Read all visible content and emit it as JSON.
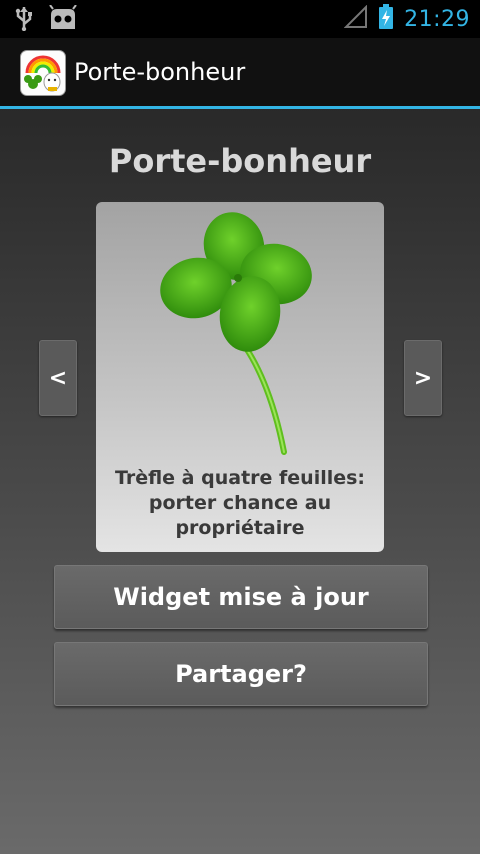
{
  "status_bar": {
    "time": "21:29",
    "icons": [
      "usb-icon",
      "android-debug-icon",
      "no-signal-icon",
      "battery-charging-icon"
    ]
  },
  "action_bar": {
    "title": "Porte-bonheur",
    "icon": "app-icon"
  },
  "main": {
    "heading": "Porte-bonheur",
    "card": {
      "image": "four-leaf-clover",
      "caption_lines": [
        "Trèfle à quatre feuilles:",
        "porter chance au",
        "propriétaire"
      ]
    },
    "prev_label": "<",
    "next_label": ">",
    "buttons": {
      "update": "Widget mise à jour",
      "share": "Partager?"
    }
  },
  "colors": {
    "accent": "#33b5e5",
    "clover": "#3f9b12"
  }
}
